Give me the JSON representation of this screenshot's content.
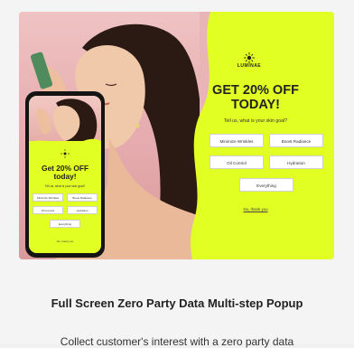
{
  "popup": {
    "brand": "LUMINAE",
    "headline_line1": "GET 20% OFF",
    "headline_line2": "TODAY!",
    "question": "Tell us, what is your skin goal?",
    "options": [
      "Minimize Wrinkles",
      "Boost Radiance",
      "Oil Control",
      "Hydration",
      "Everything"
    ],
    "no_thanks": "No, thank you"
  },
  "phone": {
    "headline_line1": "Get 20% OFF",
    "headline_line2": "today!",
    "question": "Tell us, what is your skin goal?",
    "options": [
      "Minimize Wrinkles",
      "Boost Radiance",
      "Oil Control",
      "Hydration",
      "Everything"
    ],
    "no_thanks": "No, thank you"
  },
  "card": {
    "title": "Full Screen Zero Party Data Multi-step Popup",
    "description": "Collect customer's interest with a zero party data"
  },
  "colors": {
    "accent": "#e2ff23",
    "background": "#f4f4f4",
    "photo_pink": "#e7aeb1"
  }
}
